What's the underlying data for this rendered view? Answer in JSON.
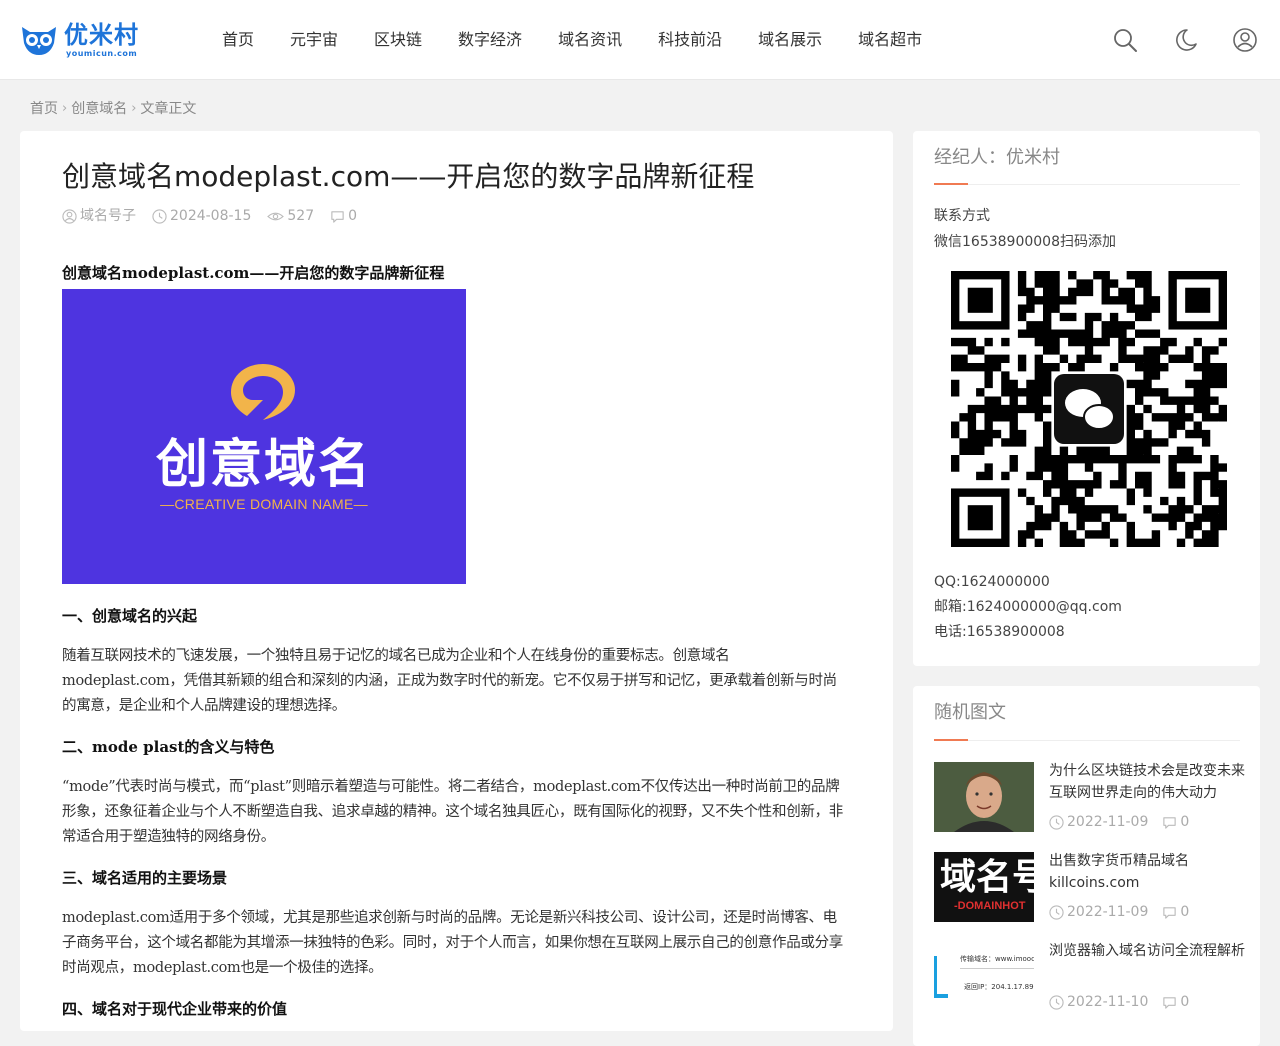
{
  "header": {
    "logo_text": "优米村",
    "logo_sub": "youmicun.com",
    "nav": [
      "首页",
      "元宇宙",
      "区块链",
      "数字经济",
      "域名资讯",
      "科技前沿",
      "域名展示",
      "域名超市"
    ],
    "icons": [
      "search-icon",
      "moon-icon",
      "user-icon"
    ]
  },
  "breadcrumb": [
    "首页",
    "创意域名",
    "文章正文"
  ],
  "article": {
    "title": "创意域名modeplast.com——开启您的数字品牌新征程",
    "meta": {
      "author": "域名号子",
      "date": "2024-08-15",
      "views": "527",
      "comments": "0"
    },
    "lead": "创意域名modeplast.com——开启您的数字品牌新征程",
    "banner": {
      "title": "创意域名",
      "subtitle": "—CREATIVE DOMAIN NAME—",
      "bg_color": "#4e34e0",
      "accent_color": "#f2b44a"
    },
    "sections": [
      {
        "heading": "一、创意域名的兴起",
        "para": "随着互联网技术的飞速发展，一个独特且易于记忆的域名已成为企业和个人在线身份的重要标志。创意域名modeplast.com，凭借其新颖的组合和深刻的内涵，正成为数字时代的新宠。它不仅易于拼写和记忆，更承载着创新与时尚的寓意，是企业和个人品牌建设的理想选择。"
      },
      {
        "heading": "二、mode plast的含义与特色",
        "para": "“mode”代表时尚与模式，而“plast”则暗示着塑造与可能性。将二者结合，modeplast.com不仅传达出一种时尚前卫的品牌形象，还象征着企业与个人不断塑造自我、追求卓越的精神。这个域名独具匠心，既有国际化的视野，又不失个性和创新，非常适合用于塑造独特的网络身份。"
      },
      {
        "heading": "三、域名适用的主要场景",
        "para": "modeplast.com适用于多个领域，尤其是那些追求创新与时尚的品牌。无论是新兴科技公司、设计公司，还是时尚博客、电子商务平台，这个域名都能为其增添一抹独特的色彩。同时，对于个人而言，如果你想在互联网上展示自己的创意作品或分享时尚观点，modeplast.com也是一个极佳的选择。"
      },
      {
        "heading": "四、域名对于现代企业带来的价值",
        "para": ""
      }
    ]
  },
  "agent": {
    "title": "经纪人：优米村",
    "contact_label": "联系方式",
    "wechat": "微信16538900008扫码添加",
    "qq": "QQ:1624000000",
    "email": "邮箱:1624000000@qq.com",
    "phone": "电话:16538900008"
  },
  "random": {
    "title": "随机图文",
    "items": [
      {
        "title": "为什么区块链技术会是改变未来互联网世界走向的伟大动力",
        "date": "2022-11-09",
        "comments": "0"
      },
      {
        "title": "出售数字货币精品域名killcoins.com",
        "date": "2022-11-09",
        "comments": "0",
        "thumb_text": "域名号",
        "thumb_sub": "-DOMAINHOT"
      },
      {
        "title": "浏览器输入域名访问全流程解析",
        "date": "2022-11-10",
        "comments": "0",
        "thumb_line1": "传输域名：www.imooc.co",
        "thumb_line2": "返回IP：204.1.17.89"
      }
    ]
  },
  "colors": {
    "brand": "#1e74d9",
    "accent": "#f07a52",
    "link": "#1a3a8a"
  }
}
